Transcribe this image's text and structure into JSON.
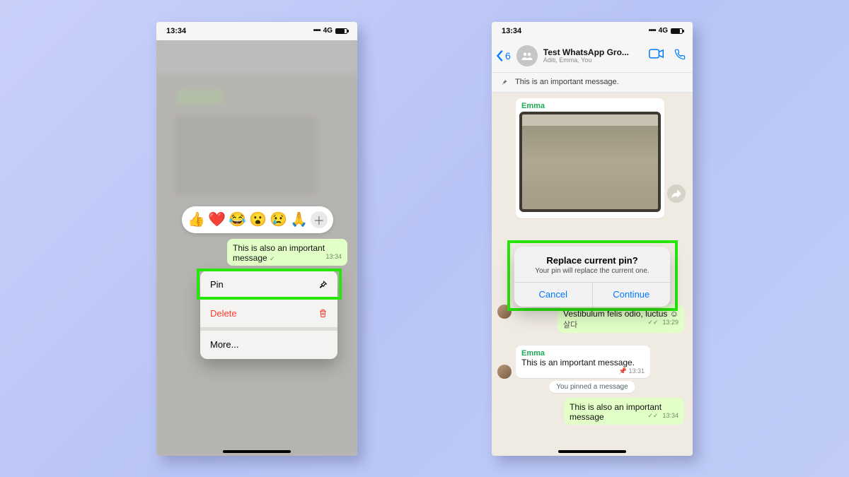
{
  "statusbar": {
    "time": "13:34",
    "network": "4G"
  },
  "left": {
    "reactions": [
      "👍",
      "❤️",
      "😂",
      "😮",
      "😢",
      "🙏"
    ],
    "selected_message": {
      "text": "This is also an important message",
      "time": "13:34"
    },
    "menu": {
      "pin": "Pin",
      "delete": "Delete",
      "more": "More..."
    }
  },
  "right": {
    "nav": {
      "back_count": "6",
      "title": "Test WhatsApp Gro...",
      "subtitle": "Aditi, Emma, You"
    },
    "pinned_banner": "This is an important message.",
    "img_sender": "Emma",
    "out_lorem": {
      "text": "Vestibulum felis odio, luctus ☺",
      "time": "13:29"
    },
    "in_important": {
      "sender": "Emma",
      "text": "This is an important message.",
      "time": "13:31"
    },
    "system_chip": "You pinned a message",
    "out_also": {
      "text": "This is also an important message",
      "time": "13:34"
    },
    "dialog": {
      "title": "Replace current pin?",
      "body": "Your pin will replace the current one.",
      "cancel": "Cancel",
      "continue": "Continue"
    }
  }
}
